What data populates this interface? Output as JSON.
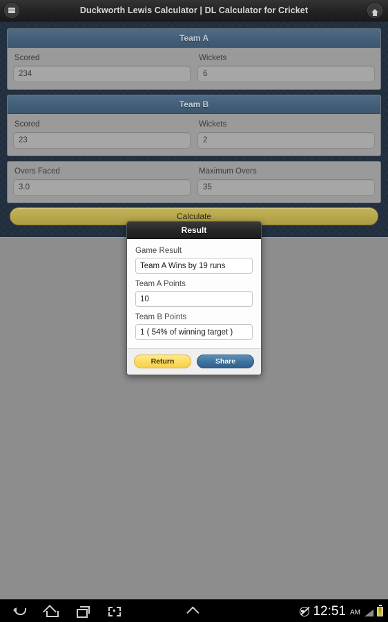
{
  "appbar": {
    "title": "Duckworth Lewis Calculator | DL Calculator for Cricket",
    "menu_icon": "menu-icon",
    "home_icon": "home-icon"
  },
  "sections": [
    {
      "header": "Team A",
      "fields": [
        {
          "label": "Scored",
          "value": "234"
        },
        {
          "label": "Wickets",
          "value": "6"
        }
      ]
    },
    {
      "header": "Team B",
      "fields": [
        {
          "label": "Scored",
          "value": "23"
        },
        {
          "label": "Wickets",
          "value": "2"
        }
      ]
    }
  ],
  "overs_section": {
    "fields": [
      {
        "label": "Overs Faced",
        "value": "3.0"
      },
      {
        "label": "Maximum Overs",
        "value": "35"
      }
    ]
  },
  "calculate_button": {
    "label": "Calculate"
  },
  "dialog": {
    "title": "Result",
    "fields": [
      {
        "label": "Game Result",
        "value": "Team A Wins by 19 runs"
      },
      {
        "label": "Team A Points",
        "value": "10"
      },
      {
        "label": "Team B Points",
        "value": "1 ( 54% of winning target )"
      }
    ],
    "buttons": {
      "return_label": "Return",
      "share_label": "Share"
    }
  },
  "navbar": {
    "back_icon": "back-icon",
    "home_icon": "home-icon",
    "recents_icon": "recent-apps-icon",
    "screenshot_icon": "screenshot-icon",
    "chevron_icon": "chevron-up-icon",
    "mute_icon": "mute-icon",
    "time": "12:51",
    "meridiem": "AM",
    "signal_icon": "signal-bars-icon",
    "battery_icon": "battery-alert-icon"
  },
  "colors": {
    "app_background": "#233040",
    "panel_header": "#44607a",
    "panel": "#9a9a9a",
    "calculate": "#b9a94f",
    "return_button": "#fcdc63",
    "share_button": "#3e74a1",
    "dim_overlay": "#8d8d8d"
  }
}
